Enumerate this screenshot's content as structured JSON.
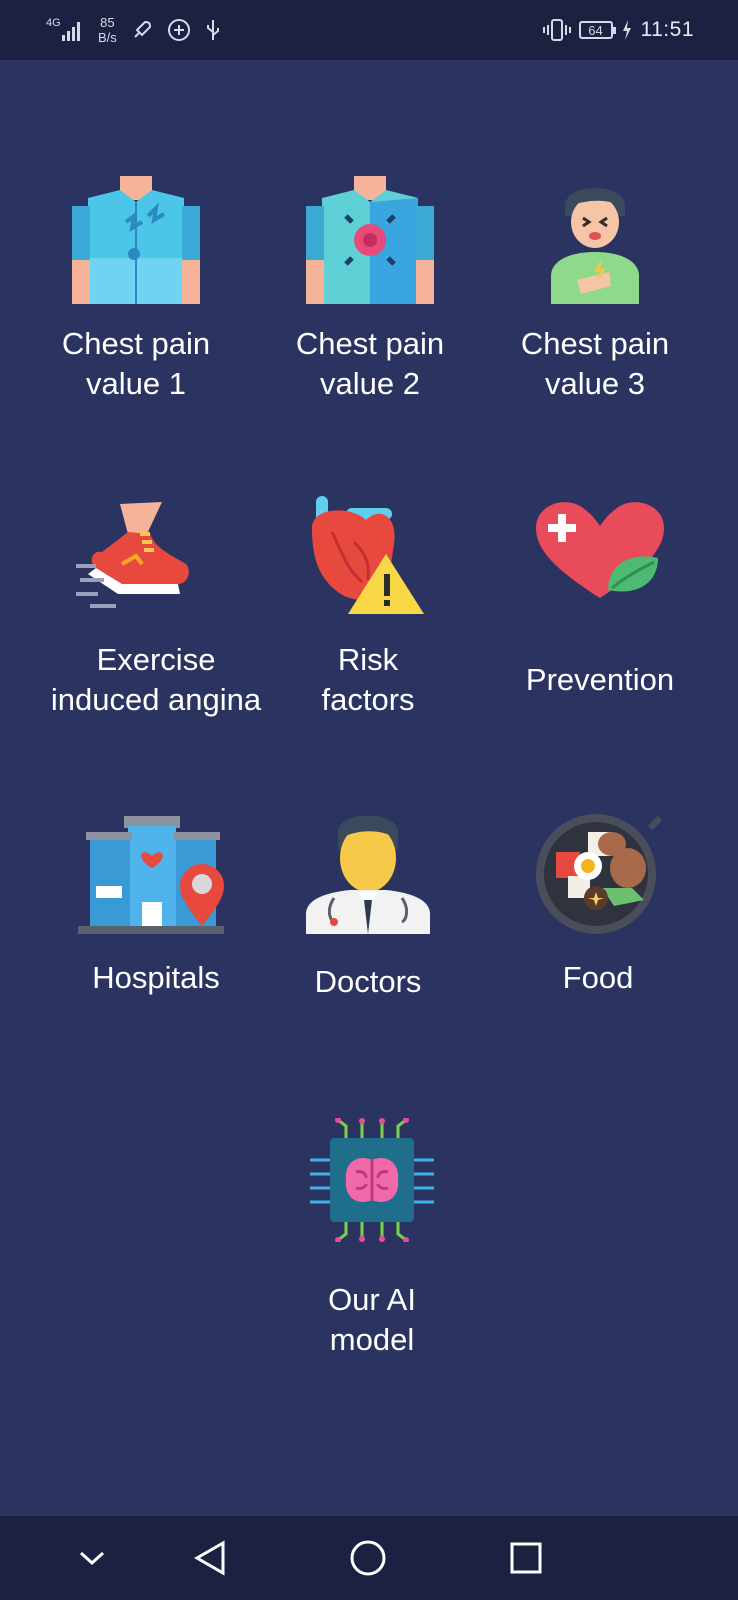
{
  "status_bar": {
    "network_type": "4G",
    "net_speed_value": "85",
    "net_speed_unit": "B/s",
    "battery_level": "64",
    "time": "11:51"
  },
  "menu": {
    "items": [
      {
        "label": "Chest pain\nvalue 1",
        "icon": "shirt-chest-pain-icon"
      },
      {
        "label": "Chest pain\nvalue 2",
        "icon": "shirt-chest-pain-center-icon"
      },
      {
        "label": "Chest pain\nvalue 3",
        "icon": "person-pain-icon"
      },
      {
        "label": "Exercise\ninduced angina",
        "icon": "running-shoe-icon"
      },
      {
        "label": "Risk\nfactors",
        "icon": "heart-warning-icon"
      },
      {
        "label": "Prevention",
        "icon": "heart-leaf-icon"
      },
      {
        "label": "Hospitals",
        "icon": "hospital-location-icon"
      },
      {
        "label": "Doctors",
        "icon": "doctor-icon"
      },
      {
        "label": "Food",
        "icon": "food-pan-icon"
      },
      {
        "label": "Our AI\nmodel",
        "icon": "ai-brain-chip-icon"
      }
    ]
  },
  "nav_bar": {
    "buttons": [
      "collapse-icon",
      "back-icon",
      "home-icon",
      "recents-icon"
    ]
  }
}
